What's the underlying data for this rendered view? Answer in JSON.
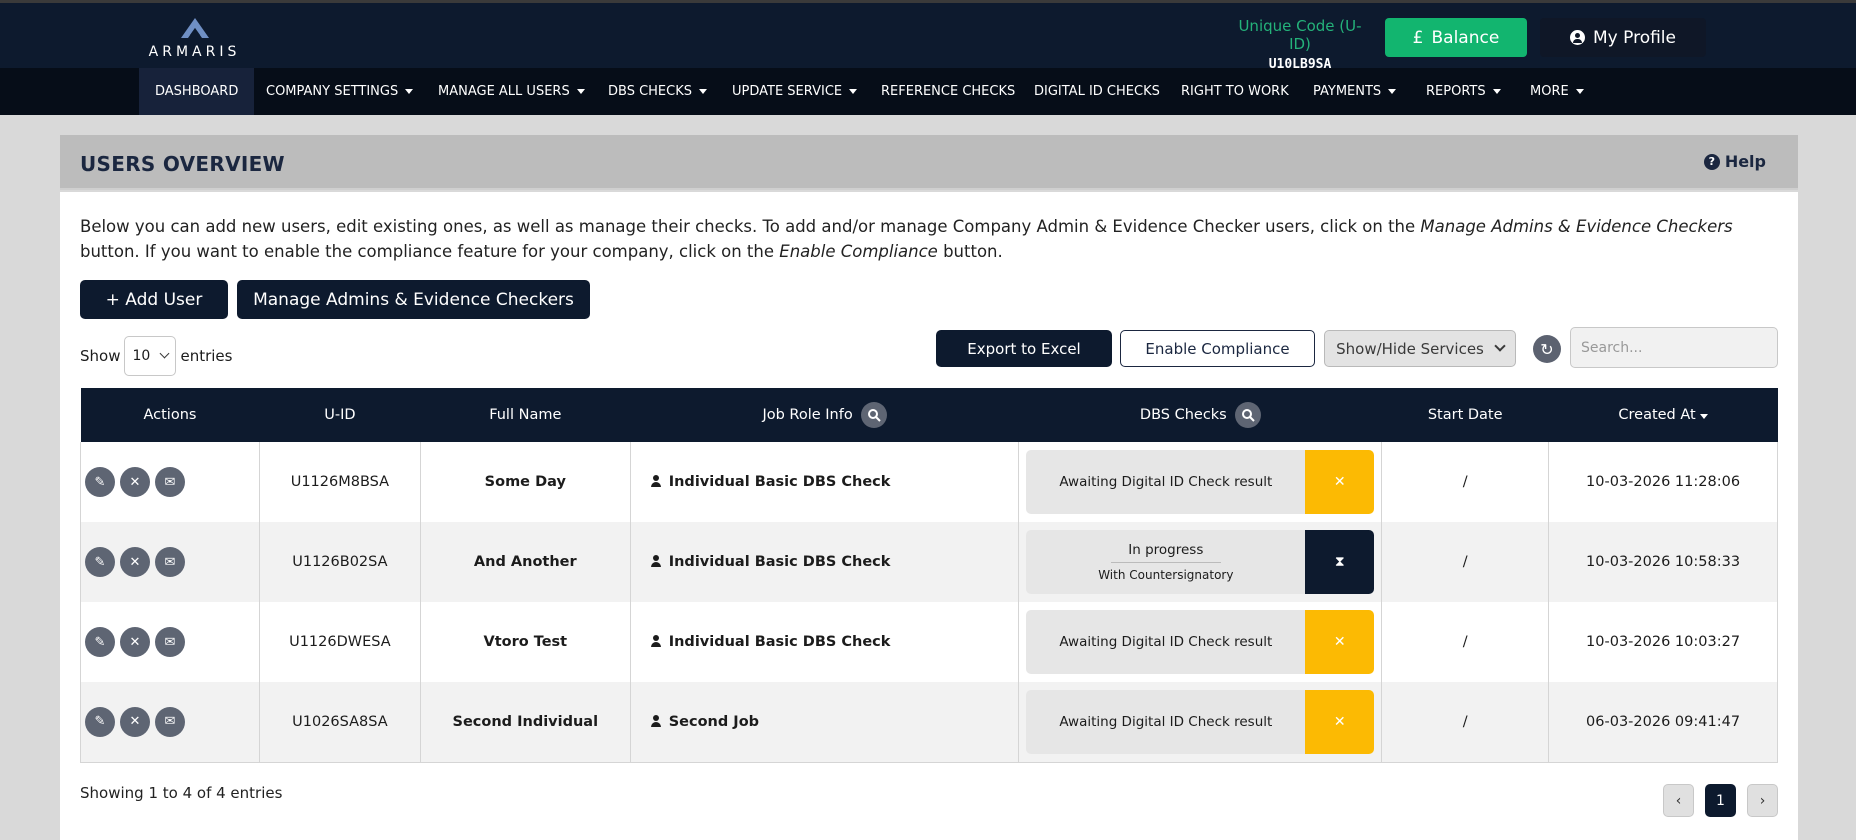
{
  "brand": {
    "name": "ARMARIS"
  },
  "header": {
    "uid_label": "Unique Code (U-ID)",
    "uid_value": "U10LB9SA",
    "balance_label": "Balance",
    "currency_symbol": "£",
    "profile_label": "My Profile"
  },
  "nav": {
    "items": [
      {
        "label": "DASHBOARD"
      },
      {
        "label": "COMPANY SETTINGS"
      },
      {
        "label": "MANAGE ALL USERS"
      },
      {
        "label": "DBS CHECKS"
      },
      {
        "label": "UPDATE SERVICE"
      },
      {
        "label": "REFERENCE CHECKS"
      },
      {
        "label": "DIGITAL ID CHECKS"
      },
      {
        "label": "RIGHT TO WORK"
      },
      {
        "label": "PAYMENTS"
      },
      {
        "label": "REPORTS"
      },
      {
        "label": "MORE"
      }
    ]
  },
  "panel": {
    "title": "USERS OVERVIEW",
    "help_label": "Help",
    "intro_1": "Below you can add new users, edit existing ones, as well as manage their checks. To add and/or manage Company Admin & Evidence Checker users, click on the ",
    "intro_em1": "Manage Admins & Evidence Checkers",
    "intro_2": " button. If you want to enable the compliance feature for your company, click on the ",
    "intro_em2": "Enable Compliance",
    "intro_3": " button."
  },
  "buttons": {
    "add_user": "+ Add User",
    "manage_admins": "Manage Admins & Evidence Checkers",
    "export": "Export to Excel",
    "compliance": "Enable Compliance",
    "showhide": "Show/Hide Services"
  },
  "entries": {
    "show_label": "Show",
    "value": "10",
    "suffix": "entries"
  },
  "search": {
    "placeholder": "Search..."
  },
  "table": {
    "columns": {
      "actions": "Actions",
      "uid": "U-ID",
      "fullname": "Full Name",
      "jobrole": "Job Role Info",
      "dbs": "DBS Checks",
      "start": "Start Date",
      "created": "Created At"
    },
    "rows": [
      {
        "uid": "U1126M8BSA",
        "name": "Some Day",
        "job": "Individual Basic DBS Check",
        "dbs": "Awaiting Digital ID Check result",
        "start": "/",
        "created": "10-03-2026 11:28:06"
      },
      {
        "uid": "U1126B02SA",
        "name": "And Another",
        "job": "Individual Basic DBS Check",
        "dbs": "In progress",
        "dbs_sub": "With Countersignatory",
        "start": "/",
        "created": "10-03-2026 10:58:33"
      },
      {
        "uid": "U1126DWESA",
        "name": "Vtoro Test",
        "job": "Individual Basic DBS Check",
        "dbs": "Awaiting Digital ID Check result",
        "start": "/",
        "created": "10-03-2026 10:03:27"
      },
      {
        "uid": "U1026SA8SA",
        "name": "Second Individual",
        "job": "Second Job",
        "dbs": "Awaiting Digital ID Check result",
        "start": "/",
        "created": "06-03-2026 09:41:47"
      }
    ]
  },
  "footer": {
    "showing": "Showing 1 to 4 of 4 entries",
    "page": "1"
  },
  "colors": {
    "navy": "#0d1a2e",
    "green": "#12b56f",
    "yellow": "#fcba03"
  }
}
